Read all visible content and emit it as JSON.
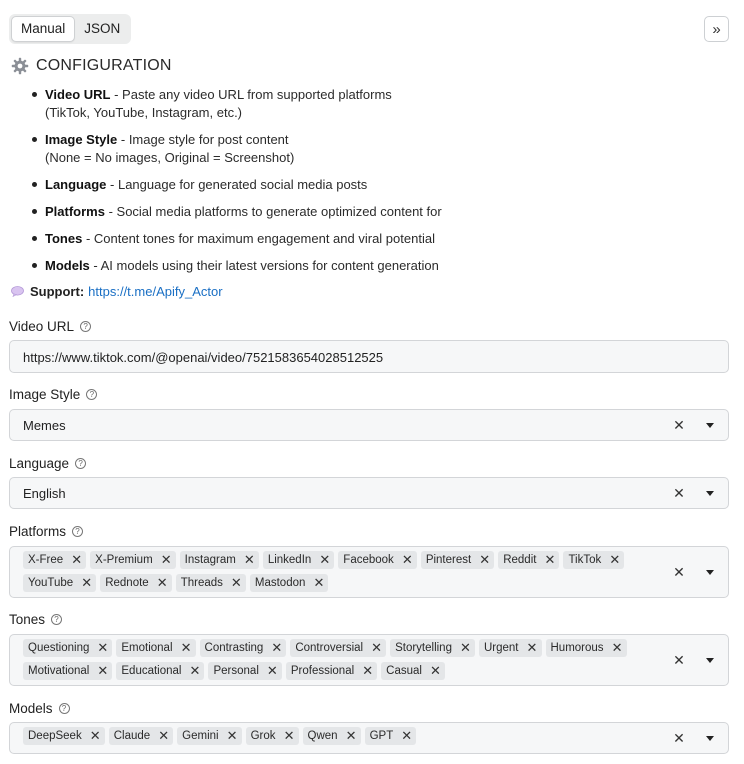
{
  "tabs": [
    {
      "label": "Manual",
      "active": true
    },
    {
      "label": "JSON",
      "active": false
    }
  ],
  "collapse_glyph": "»",
  "config": {
    "icon": "gear-icon",
    "title": "CONFIGURATION",
    "items": [
      {
        "term": "Video URL",
        "text": " - Paste any video URL from supported platforms",
        "text2": "(TikTok, YouTube, Instagram, etc.)"
      },
      {
        "term": "Image Style",
        "text": " - Image style for post content",
        "text2": "(None = No images, Original = Screenshot)"
      },
      {
        "term": "Language",
        "text": " - Language for generated social media posts",
        "text2": ""
      },
      {
        "term": "Platforms",
        "text": " - Social media platforms to generate optimized content for",
        "text2": ""
      },
      {
        "term": "Tones",
        "text": " - Content tones for maximum engagement and viral potential",
        "text2": ""
      },
      {
        "term": "Models",
        "text": " - AI models using their latest versions for content generation",
        "text2": ""
      }
    ]
  },
  "support": {
    "label": "Support:",
    "link": "https://t.me/Apify_Actor",
    "icon": "speech-bubble-icon"
  },
  "fields": {
    "video_url": {
      "label": "Video URL",
      "value": "https://www.tiktok.com/@openai/video/7521583654028512525"
    },
    "image_style": {
      "label": "Image Style",
      "value": "Memes"
    },
    "language": {
      "label": "Language",
      "value": "English"
    },
    "platforms": {
      "label": "Platforms",
      "chips": [
        "X-Free",
        "X-Premium",
        "Instagram",
        "LinkedIn",
        "Facebook",
        "Pinterest",
        "Reddit",
        "TikTok",
        "YouTube",
        "Rednote",
        "Threads",
        "Mastodon"
      ]
    },
    "tones": {
      "label": "Tones",
      "chips": [
        "Questioning",
        "Emotional",
        "Contrasting",
        "Controversial",
        "Storytelling",
        "Urgent",
        "Humorous",
        "Motivational",
        "Educational",
        "Personal",
        "Professional",
        "Casual"
      ]
    },
    "models": {
      "label": "Models",
      "chips": [
        "DeepSeek",
        "Claude",
        "Gemini",
        "Grok",
        "Qwen",
        "GPT"
      ]
    }
  },
  "glyphs": {
    "clear": "✕",
    "chip_remove": "✕",
    "help": "?"
  },
  "colors": {
    "link": "#1a6fc4",
    "field_bg": "#f6f7f8",
    "chip_bg": "#e4e6e8",
    "border": "#d3d5d8"
  }
}
